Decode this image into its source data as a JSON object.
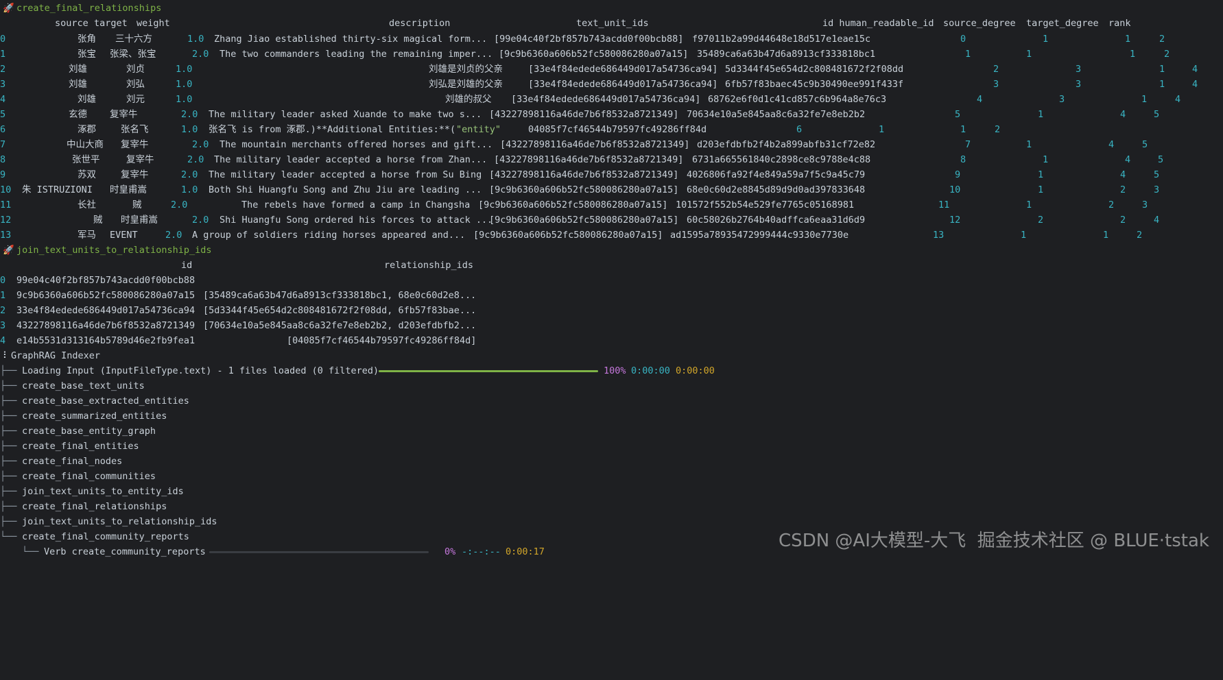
{
  "section1": {
    "title": "create_final_relationships",
    "header": {
      "source": "source",
      "target": "target",
      "weight": "weight",
      "description": "description",
      "text_unit_ids": "text_unit_ids",
      "id_hr": "id human_readable_id",
      "source_degree": "source_degree",
      "target_degree": "target_degree",
      "rank": "rank"
    },
    "rows": [
      {
        "idx": "0",
        "source": "张角",
        "target": "三十六方",
        "weight": "1.0",
        "desc": "Zhang Jiao established thirty-six magical form...",
        "tuids": "[99e04c40f2bf857b743acdd0f00bcb88]",
        "id": "f97011b2a99d44648e18d517e1eae15c",
        "hr": "0",
        "sd": "1",
        "td": "1",
        "rank": "2"
      },
      {
        "idx": "1",
        "source": "张宝",
        "target": "张梁、张宝",
        "weight": "2.0",
        "desc": "The two commanders leading the remaining imper...",
        "tuids": "[9c9b6360a606b52fc580086280a07a15]",
        "id": "35489ca6a63b47d6a8913cf333818bc1",
        "hr": "1",
        "sd": "1",
        "td": "1",
        "rank": "2"
      },
      {
        "idx": "2",
        "source": "刘雄",
        "target": "刘贞",
        "weight": "1.0",
        "desc": "刘雄是刘贞的父亲",
        "tuids": "[33e4f84edede686449d017a54736ca94]",
        "id": "5d3344f45e654d2c808481672f2f08dd",
        "hr": "2",
        "sd": "3",
        "td": "1",
        "rank": "4"
      },
      {
        "idx": "3",
        "source": "刘雄",
        "target": "刘弘",
        "weight": "1.0",
        "desc": "刘弘是刘雄的父亲",
        "tuids": "[33e4f84edede686449d017a54736ca94]",
        "id": "6fb57f83baec45c9b30490ee991f433f",
        "hr": "3",
        "sd": "3",
        "td": "1",
        "rank": "4"
      },
      {
        "idx": "4",
        "source": "刘雄",
        "target": "刘元",
        "weight": "1.0",
        "desc": "刘雄的叔父",
        "tuids": "[33e4f84edede686449d017a54736ca94]",
        "id": "68762e6f0d1c41cd857c6b964a8e76c3",
        "hr": "4",
        "sd": "3",
        "td": "1",
        "rank": "4"
      },
      {
        "idx": "5",
        "source": "玄德",
        "target": "复宰牛",
        "weight": "2.0",
        "desc": "The military leader asked Xuande to make two s...",
        "tuids": "[43227898116a46de7b6f8532a8721349]",
        "id": "70634e10a5e845aa8c6a32fe7e8eb2b2",
        "hr": "5",
        "sd": "1",
        "td": "4",
        "rank": "5"
      },
      {
        "idx": "6",
        "source": "涿郡",
        "target": "张名飞",
        "weight": "1.0",
        "desc": "张名飞 is from 涿郡.)**Additional Entities:**(",
        "desc_str": "\"entity\"",
        "tuids": "",
        "id": "04085f7cf46544b79597fc49286ff84d",
        "hr": "6",
        "sd": "1",
        "td": "1",
        "rank": "2"
      },
      {
        "idx": "7",
        "source": "中山大商",
        "target": "复宰牛",
        "weight": "2.0",
        "desc": "The mountain merchants offered horses and gift...",
        "tuids": "[43227898116a46de7b6f8532a8721349]",
        "id": "d203efdbfb2f4b2a899abfb31cf72e82",
        "hr": "7",
        "sd": "1",
        "td": "4",
        "rank": "5"
      },
      {
        "idx": "8",
        "source": "张世平",
        "target": "复宰牛",
        "weight": "2.0",
        "desc": "The military leader accepted a horse from Zhan...",
        "tuids": "[43227898116a46de7b6f8532a8721349]",
        "id": "6731a665561840c2898ce8c9788e4c88",
        "hr": "8",
        "sd": "1",
        "td": "4",
        "rank": "5"
      },
      {
        "idx": "9",
        "source": "苏双",
        "target": "复宰牛",
        "weight": "2.0",
        "desc": "The military leader accepted a horse from Su Bing",
        "tuids": "[43227898116a46de7b6f8532a8721349]",
        "id": "4026806fa92f4e849a59a7f5c9a45c79",
        "hr": "9",
        "sd": "1",
        "td": "4",
        "rank": "5"
      },
      {
        "idx": "10",
        "source": "朱 ISTRUZIONI",
        "target": "时皇甫嵩",
        "weight": "1.0",
        "desc": "Both Shi Huangfu Song and Zhu Jiu are leading ...",
        "tuids": "[9c9b6360a606b52fc580086280a07a15]",
        "id": "68e0c60d2e8845d89d9d0ad397833648",
        "hr": "10",
        "sd": "1",
        "td": "2",
        "rank": "3"
      },
      {
        "idx": "11",
        "source": "长社",
        "target": "贼",
        "weight": "2.0",
        "desc": "The rebels have formed a camp in Changsha",
        "tuids": "[9c9b6360a606b52fc580086280a07a15]",
        "id": "101572f552b54e529fe7765c05168981",
        "hr": "11",
        "sd": "1",
        "td": "2",
        "rank": "3"
      },
      {
        "idx": "12",
        "source": "贼",
        "target": "时皇甫嵩",
        "weight": "2.0",
        "desc": "Shi Huangfu Song ordered his forces to attack ...",
        "tuids": "[9c9b6360a606b52fc580086280a07a15]",
        "id": "60c58026b2764b40adffca6eaa31d6d9",
        "hr": "12",
        "sd": "2",
        "td": "2",
        "rank": "4"
      },
      {
        "idx": "13",
        "source": "军马",
        "target": "EVENT",
        "weight": "2.0",
        "desc": "A group of soldiers riding horses appeared and...",
        "tuids": "[9c9b6360a606b52fc580086280a07a15]",
        "id": "ad1595a78935472999444c9330e7730e",
        "hr": "13",
        "sd": "1",
        "td": "1",
        "rank": "2"
      }
    ]
  },
  "section2": {
    "title": "join_text_units_to_relationship_ids",
    "header_id": "id",
    "header_rel": "relationship_ids",
    "rows": [
      {
        "idx": "0",
        "id": "99e04c40f2bf857b743acdd0f00bcb88",
        "rel": ""
      },
      {
        "idx": "1",
        "id": "9c9b6360a606b52fc580086280a07a15",
        "rel": "[35489ca6a63b47d6a8913cf333818bc1, 68e0c60d2e8..."
      },
      {
        "idx": "2",
        "id": "33e4f84edede686449d017a54736ca94",
        "rel": "[5d3344f45e654d2c808481672f2f08dd, 6fb57f83bae..."
      },
      {
        "idx": "3",
        "id": "43227898116a46de7b6f8532a8721349",
        "rel": "[70634e10a5e845aa8c6a32fe7e8eb2b2, d203efdbfb2..."
      },
      {
        "idx": "4",
        "id": "e14b5531d313164b5789d46e2fb9fea1",
        "rel": "[04085f7cf46544b79597fc49286ff84d]"
      }
    ]
  },
  "indexer": {
    "root_prefix": "⠸",
    "root": "GraphRAG Indexer",
    "loading": {
      "label": "Loading Input (InputFileType.text) - 1 files loaded (0 filtered)",
      "progress": 1.0,
      "percent": "100%",
      "elapsed": "0:00:00",
      "remaining": "0:00:00"
    },
    "steps": [
      "create_base_text_units",
      "create_base_extracted_entities",
      "create_summarized_entities",
      "create_base_entity_graph",
      "create_final_entities",
      "create_final_nodes",
      "create_final_communities",
      "join_text_units_to_entity_ids",
      "create_final_relationships",
      "join_text_units_to_relationship_ids",
      "create_final_community_reports"
    ],
    "verb": {
      "label": "Verb create_community_reports",
      "progress": 0.0,
      "percent": "0%",
      "elapsed": "-:--:--",
      "remaining": "0:00:17"
    }
  },
  "watermark": "CSDN @AI大模型-大飞  掘金技术社区 @ BLUE·tstak",
  "colors": {
    "background": "#1e1f22",
    "green": "#7fb347",
    "cyan": "#39b5c4",
    "magenta": "#c678dd",
    "yellow": "#d2a62a"
  },
  "icons": {
    "rocket": "rocket-icon"
  }
}
